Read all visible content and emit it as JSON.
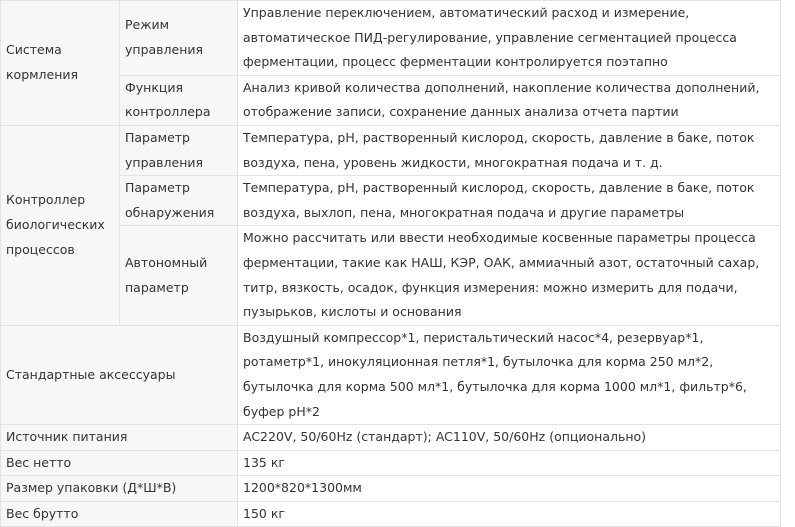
{
  "table": {
    "feeding": {
      "group": "Система кормления",
      "rows": [
        {
          "param": "Режим управления",
          "value": "Управление переключением, автоматический расход и измерение, автоматическое ПИД-регулирование, управление сегментацией процесса ферментации, процесс ферментации контролируется поэтапно"
        },
        {
          "param": "Функция контроллера",
          "value": "Анализ кривой количества дополнений, накопление количества дополнений, отображение записи, сохранение данных анализа отчета партии"
        }
      ]
    },
    "bio": {
      "group": "Контроллер биологических процессов",
      "rows": [
        {
          "param": "Параметр управления",
          "value": "Температура, pH, растворенный кислород, скорость, давление в баке, поток воздуха, пена, уровень жидкости, многократная подача и т. д."
        },
        {
          "param": "Параметр обнаружения",
          "value": "Температура, pH, растворенный кислород, скорость, давление в баке, поток воздуха, выхлоп, пена, многократная подача и другие параметры"
        },
        {
          "param": "Автономный параметр",
          "value": "Можно рассчитать или ввести необходимые косвенные параметры процесса ферментации, такие как НАШ, КЭР, ОАК, аммиачный азот, остаточный сахар, титр, вязкость, осадок, функция измерения: можно измерить для подачи, пузырьков, кислоты и основания"
        }
      ]
    },
    "accessories": {
      "label": "Стандартные аксессуары",
      "value": "Воздушный компрессор*1, перистальтический насос*4, резервуар*1, ротаметр*1, инокуляционная петля*1, бутылочка для корма 250 мл*2, бутылочка для корма 500 мл*1, бутылочка для корма 1000 мл*1, фильтр*6, буфер pH*2"
    },
    "simple_rows": [
      {
        "label": "Источник питания",
        "value": "AC220V, 50/60Hz (стандарт); AC110V, 50/60Hz (опционально)"
      },
      {
        "label": "Вес нетто",
        "value": "135 кг"
      },
      {
        "label": "Размер упаковки (Д*Ш*В)",
        "value": "1200*820*1300мм"
      },
      {
        "label": "Вес брутто",
        "value": "150 кг"
      }
    ]
  }
}
